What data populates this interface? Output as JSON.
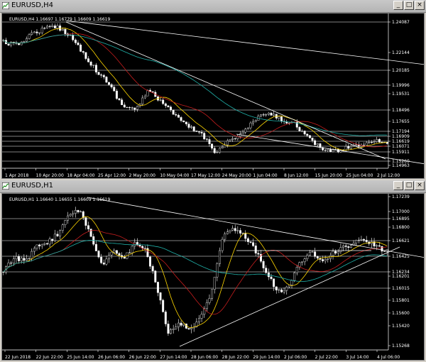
{
  "top": {
    "window_title": "EURUSD,H4",
    "info": "EURUSD,H4  1.16697 1.16779 1.16609 1.16619",
    "price_labels": [
      "1.24087",
      "1.22144",
      "1.20185",
      "1.19996",
      "1.19531",
      "1.18496",
      "1.17655",
      "1.17194",
      "1.16909",
      "1.16619",
      "1.16071",
      "1.15911",
      "1.15260",
      "1.14963"
    ],
    "time_labels": [
      "1 Apr 2018",
      "10 Apr 20:00",
      "18 Apr 04:00",
      "25 Apr 12:00",
      "2 May 20:00",
      "10 May 04:00",
      "17 May 12:00",
      "24 May 20:00",
      "1 Jun 04:00",
      "8 Jun 12:00",
      "15 Jun 20:00",
      "25 Jun 04:00",
      "2 Jul 12:00"
    ]
  },
  "bottom": {
    "window_title": "EURUSD,H1",
    "info": "EURUSD,H1  1.16640 1.16655 1.16609 1.16619",
    "price_labels": [
      "1.17239",
      "1.17000",
      "1.16895",
      "1.16800",
      "1.16621",
      "1.16425",
      "1.16234",
      "1.16201",
      "1.16015",
      "1.15801",
      "1.15600",
      "1.15420",
      "1.15268"
    ],
    "time_labels": [
      "22 Jun 2018",
      "22 Jun 22:00",
      "25 Jun 14:00",
      "26 Jun 06:00",
      "26 Jun 22:00",
      "27 Jun 14:00",
      "28 Jun 06:00",
      "28 Jun 22:00",
      "29 Jun 14:00",
      "2 Jul 06:00",
      "2 Jul 22:00",
      "3 Jul 14:00",
      "4 Jul 06:00"
    ]
  },
  "window_buttons": {
    "minimize": "_",
    "maximize": "□",
    "close": "×"
  },
  "colors": {
    "bg": "#000000",
    "grid": "#ffffff",
    "bull": "#ffffff",
    "bear": "#ffffff",
    "ma_fast": "#ffd700",
    "ma_mid": "#c81e1e",
    "ma_slow": "#20b2aa",
    "trend": "#ffffff"
  }
}
